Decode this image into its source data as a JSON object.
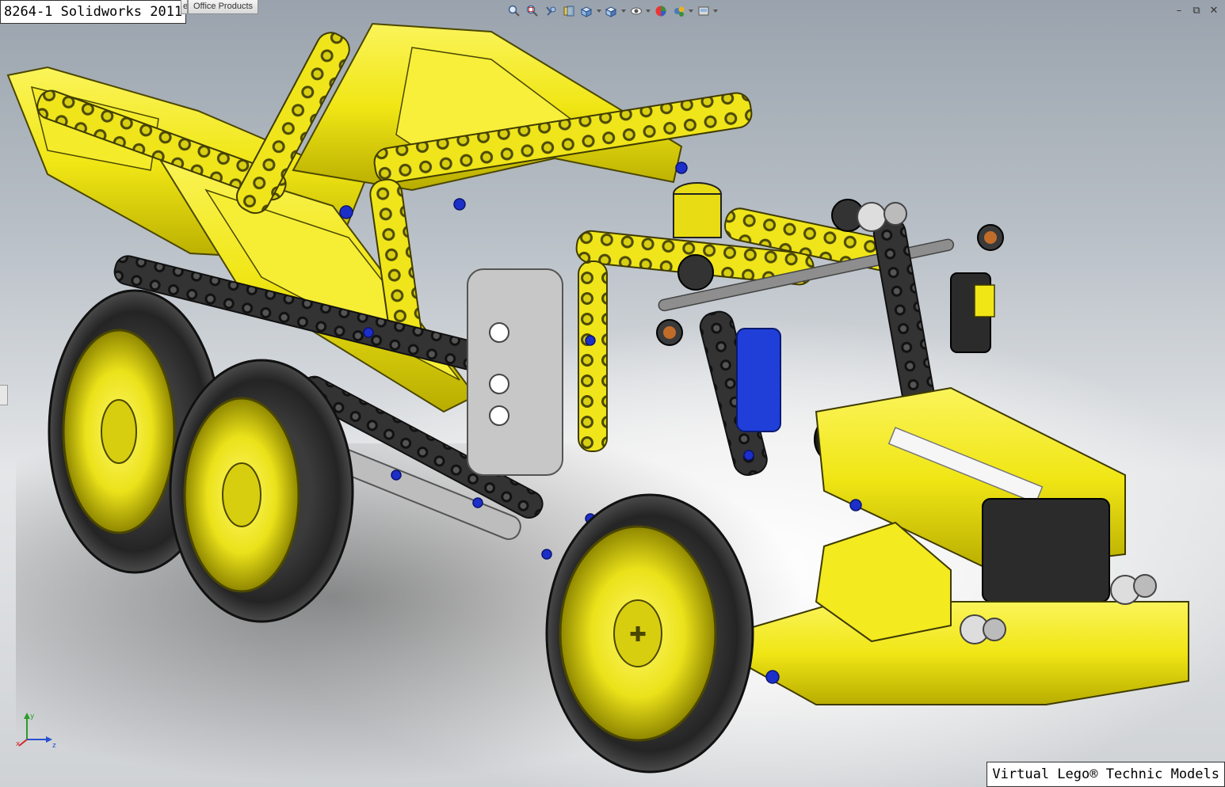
{
  "title_label": "8264-1 Solidworks 2011",
  "tabs": [
    {
      "label": "e"
    },
    {
      "label": "Office Products"
    }
  ],
  "heads_up_toolbar": [
    {
      "icon": "zoom-to-fit-icon"
    },
    {
      "icon": "zoom-to-area-icon"
    },
    {
      "icon": "previous-view-icon"
    },
    {
      "icon": "section-view-icon"
    },
    {
      "icon": "view-orientation-icon"
    },
    {
      "icon": "display-style-icon"
    },
    {
      "icon": "hide-show-items-icon"
    },
    {
      "icon": "edit-appearance-icon"
    },
    {
      "icon": "apply-scene-icon"
    },
    {
      "icon": "view-settings-icon"
    }
  ],
  "window_controls": {
    "minimize": "–",
    "restore": "⧉",
    "close": "✕"
  },
  "triad_axes": {
    "x": "x",
    "y": "y",
    "z": "z"
  },
  "watermark": "Virtual Lego® Technic Models",
  "colors": {
    "model_yellow": "#f2ea1a",
    "model_dark": "#2e2e2e",
    "model_grey": "#bdbdbd",
    "model_blue": "#1f3fd8",
    "background_top": "#9aa3ad",
    "background_bottom": "#e4e6e8"
  }
}
